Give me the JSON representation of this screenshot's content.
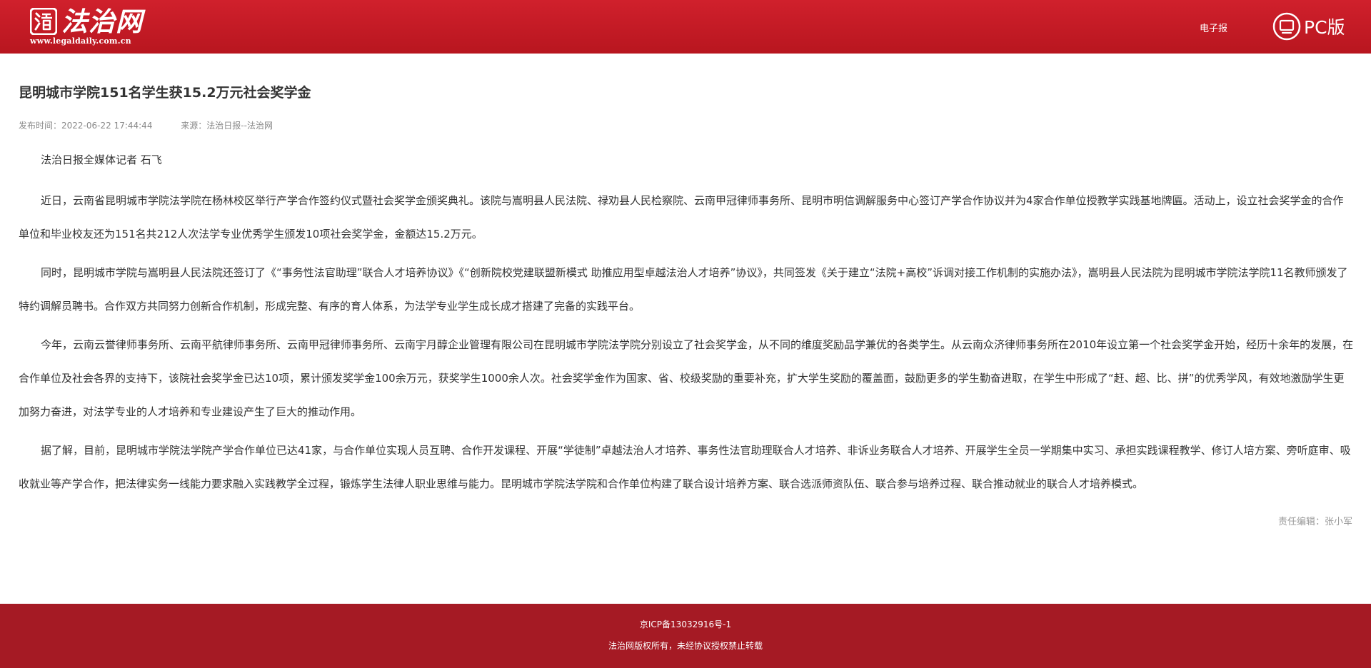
{
  "header": {
    "logo": {
      "name": "法治网",
      "url_text": "www.legaldaily.com.cn"
    },
    "epaper_label": "电子报",
    "pc_label": "PC版",
    "background_color": "#c41a25"
  },
  "article": {
    "title": "昆明城市学院151名学生获15.2万元社会奖学金",
    "publish_time": "发布时间：2022-06-22 17:44:44",
    "source": "来源：法治日报--法治网",
    "byline": "法治日报全媒体记者 石飞",
    "paragraphs": [
      "近日，云南省昆明城市学院法学院在杨林校区举行产学合作签约仪式暨社会奖学金颁奖典礼。该院与嵩明县人民法院、禄劝县人民检察院、云南甲冠律师事务所、昆明市明信调解服务中心签订产学合作协议并为4家合作单位授教学实践基地牌匾。活动上，设立社会奖学金的合作单位和毕业校友还为151名共212人次法学专业优秀学生颁发10项社会奖学金，金额达15.2万元。",
      "同时，昆明城市学院与嵩明县人民法院还签订了《“事务性法官助理”联合人才培养协议》《“创新院校党建联盟新模式 助推应用型卓越法治人才培养”协议》，共同签发《关于建立“法院+高校”诉调对接工作机制的实施办法》，嵩明县人民法院为昆明城市学院法学院11名教师颁发了特约调解员聘书。合作双方共同努力创新合作机制，形成完整、有序的育人体系，为法学专业学生成长成才搭建了完备的实践平台。",
      "今年，云南云誉律师事务所、云南平航律师事务所、云南甲冠律师事务所、云南宇月醇企业管理有限公司在昆明城市学院法学院分别设立了社会奖学金，从不同的维度奖励品学兼优的各类学生。从云南众济律师事务所在2010年设立第一个社会奖学金开始，经历十余年的发展，在合作单位及社会各界的支持下，该院社会奖学金已达10项，累计颁发奖学金100余万元，获奖学生1000余人次。社会奖学金作为国家、省、校级奖励的重要补充，扩大学生奖励的覆盖面，鼓励更多的学生勤奋进取，在学生中形成了“赶、超、比、拼”的优秀学风，有效地激励学生更加努力奋进，对法学专业的人才培养和专业建设产生了巨大的推动作用。",
      "据了解，目前，昆明城市学院法学院产学合作单位已达41家，与合作单位实现人员互聘、合作开发课程、开展“学徒制”卓越法治人才培养、事务性法官助理联合人才培养、非诉业务联合人才培养、开展学生全员一学期集中实习、承担实践课程教学、修订人培方案、旁听庭审、吸收就业等产学合作，把法律实务一线能力要求融入实践教学全过程，锻炼学生法律人职业思维与能力。昆明城市学院法学院和合作单位构建了联合设计培养方案、联合选派师资队伍、联合参与培养过程、联合推动就业的联合人才培养模式。"
    ],
    "editor": "责任编辑：张小军"
  },
  "footer": {
    "icp": "京ICP备13032916号-1",
    "copyright": "法治网版权所有，未经协议授权禁止转载",
    "background_color": "#a51a24"
  },
  "icons": {
    "logo_mark": "legaldaily-logo-icon",
    "pc": "pc-version-icon"
  }
}
